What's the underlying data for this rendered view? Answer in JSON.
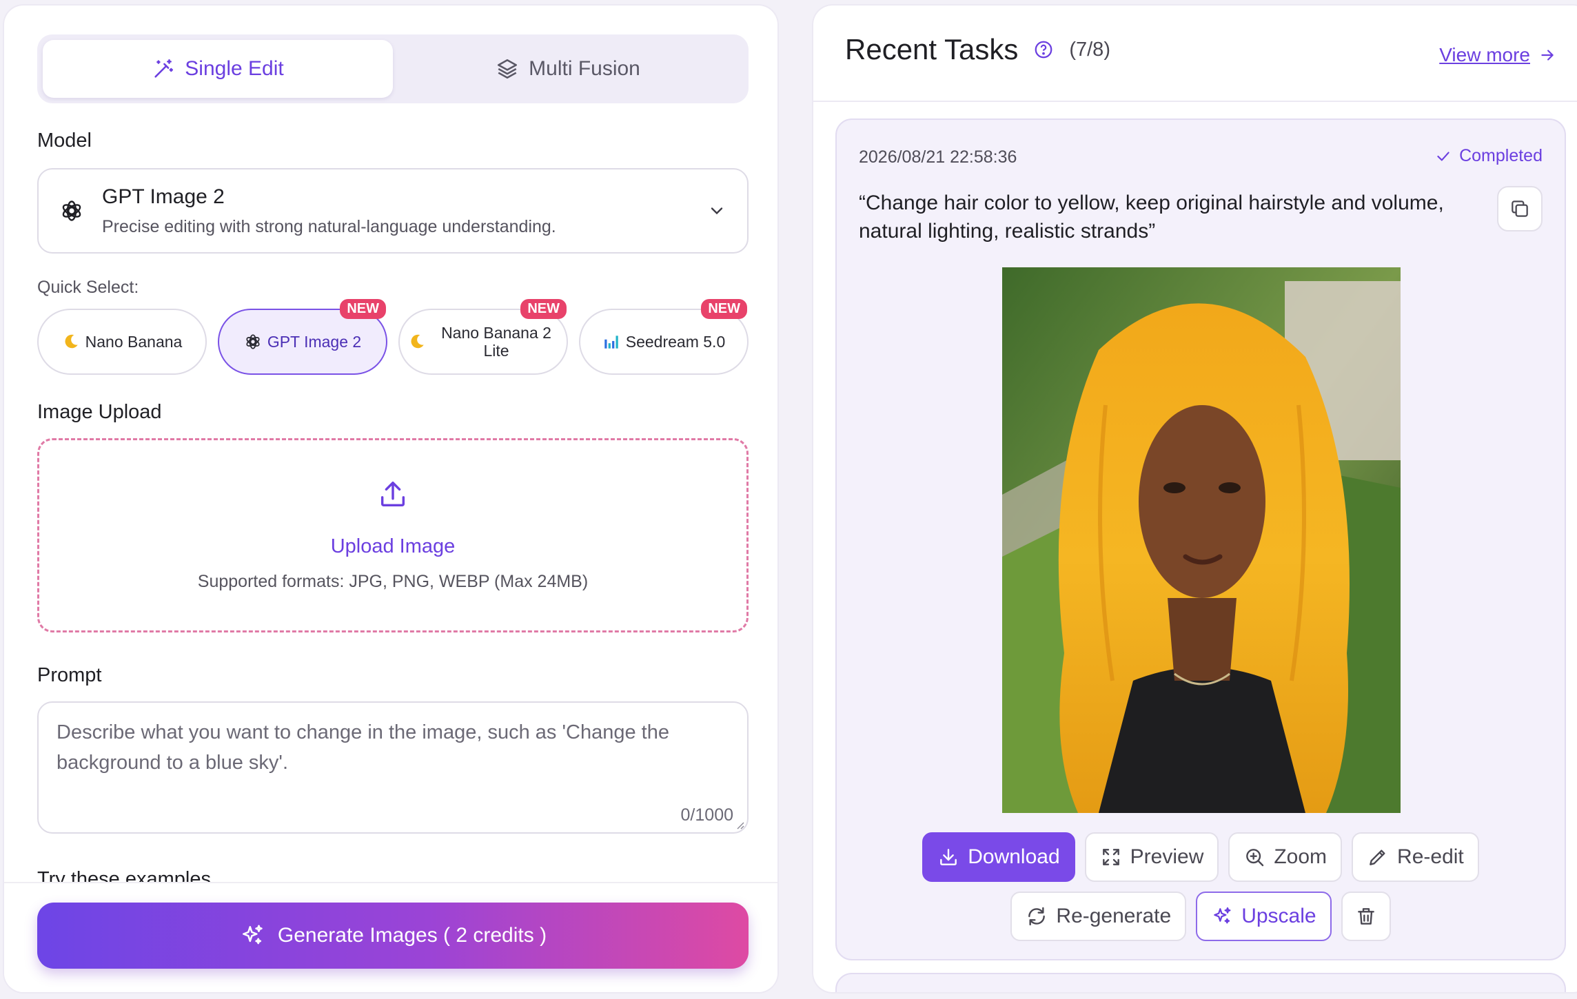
{
  "tabs": {
    "single_edit": "Single Edit",
    "multi_fusion": "Multi Fusion"
  },
  "model": {
    "label": "Model",
    "name": "GPT Image 2",
    "description": "Precise editing with strong natural-language understanding."
  },
  "quick_select": {
    "label": "Quick Select:",
    "options": [
      {
        "label": "Nano Banana",
        "badge": ""
      },
      {
        "label": "GPT Image 2",
        "badge": "NEW"
      },
      {
        "label_line1": "Nano Banana 2",
        "label_line2": "Lite",
        "badge": "NEW"
      },
      {
        "label": "Seedream 5.0",
        "badge": "NEW"
      }
    ]
  },
  "upload": {
    "label": "Image Upload",
    "title": "Upload Image",
    "formats": "Supported formats: JPG, PNG, WEBP (Max 24MB)"
  },
  "prompt": {
    "label": "Prompt",
    "placeholder": "Describe what you want to change in the image, such as 'Change the background to a blue sky'.",
    "counter": "0/1000"
  },
  "examples_label": "Try these examples",
  "generate_label": "Generate Images ( 2 credits )",
  "recent": {
    "title": "Recent Tasks",
    "count": "(7/8)",
    "view_more": "View more"
  },
  "task": {
    "timestamp": "2026/08/21 22:58:36",
    "status": "Completed",
    "prompt": "“Change hair color to yellow, keep original hairstyle and volume, natural lighting, realistic strands”",
    "actions": {
      "download": "Download",
      "preview": "Preview",
      "zoom": "Zoom",
      "re_edit": "Re-edit",
      "re_generate": "Re-generate",
      "upscale": "Upscale"
    }
  },
  "colors": {
    "accent": "#6b3fe0",
    "badge": "#e8426a",
    "upload_border": "#e07aa6"
  }
}
